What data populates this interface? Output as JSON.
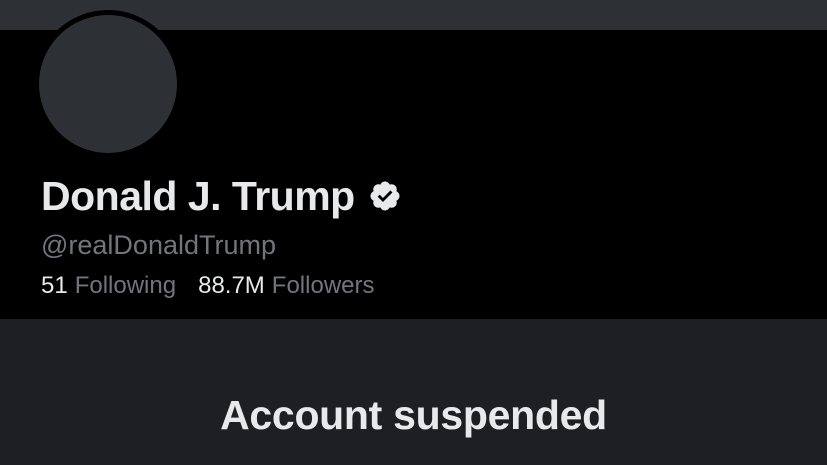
{
  "profile": {
    "display_name": "Donald J. Trump",
    "verified_icon": "verified-badge-icon",
    "handle": "@realDonaldTrump",
    "following_count": "51",
    "following_label": "Following",
    "followers_count": "88.7M",
    "followers_label": "Followers"
  },
  "status": {
    "heading": "Account suspended"
  },
  "colors": {
    "page_background": "#1d1f23",
    "banner": "#2d3034",
    "profile_panel": "#000000",
    "primary_text": "#e7e9ea",
    "secondary_text": "#71767b",
    "verified_badge": "#e7e9ea"
  }
}
